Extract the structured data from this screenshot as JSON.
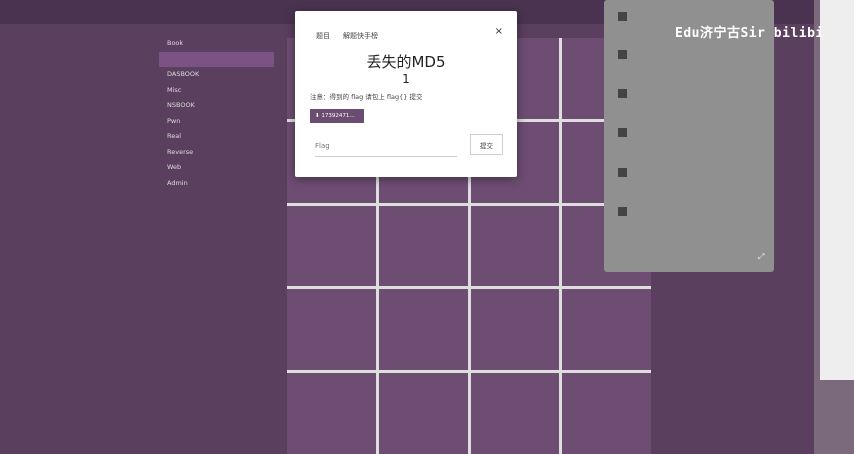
{
  "app": {
    "title": ""
  },
  "sidebar": {
    "items": [
      {
        "label": "Book",
        "active": false
      },
      {
        "label": "",
        "active": true
      },
      {
        "label": "DASBOOK",
        "active": false
      },
      {
        "label": "Misc",
        "active": false
      },
      {
        "label": "NSBOOK",
        "active": false
      },
      {
        "label": "Pwn",
        "active": false
      },
      {
        "label": "Real",
        "active": false
      },
      {
        "label": "Reverse",
        "active": false
      },
      {
        "label": "Web",
        "active": false
      },
      {
        "label": "Admin",
        "active": false
      }
    ]
  },
  "grid": {
    "tiles": [
      {
        "name": "",
        "score": ""
      },
      {
        "name": "",
        "score": ""
      },
      {
        "name": "",
        "score": ""
      },
      {
        "name": "",
        "score": ""
      },
      {
        "name": "",
        "score": ""
      },
      {
        "name": "",
        "score": ""
      },
      {
        "name": "",
        "score": ""
      },
      {
        "name": "",
        "score": ""
      },
      {
        "name": "",
        "score": ""
      },
      {
        "name": "",
        "score": ""
      },
      {
        "name": "",
        "score": ""
      },
      {
        "name": "",
        "score": ""
      },
      {
        "name": "",
        "score": ""
      },
      {
        "name": "",
        "score": ""
      },
      {
        "name": "",
        "score": ""
      },
      {
        "name": "",
        "score": ""
      },
      {
        "name": "",
        "score": ""
      },
      {
        "name": "",
        "score": ""
      },
      {
        "name": "",
        "score": ""
      },
      {
        "name": "",
        "score": ""
      }
    ]
  },
  "downloads": {
    "title": "",
    "items": [
      {
        "line1": "",
        "line2": "",
        "line3": ""
      },
      {
        "line1": "",
        "line2": "",
        "line3": ""
      },
      {
        "line1": "",
        "line2": "",
        "line3": ""
      },
      {
        "line1": "",
        "line2": "",
        "line3": ""
      },
      {
        "line1": "",
        "line2": "",
        "line3": ""
      },
      {
        "line1": "",
        "line2": "",
        "line3": ""
      }
    ],
    "footer": "",
    "icons": {
      "file": "file-icon",
      "expand": "expand-icon"
    }
  },
  "watermark": "Edu济宁古Sir bilibi",
  "modal": {
    "tabs": [
      "题目",
      "解题快手榜"
    ],
    "title": "丢失的MD5",
    "score": "1",
    "notice": "注意：得到的 flag 请包上 flag{} 提交",
    "file_button": "17392471...",
    "flag_placeholder": "Flag",
    "submit_label": "提交",
    "close_icon": "×"
  },
  "colors": {
    "background": "#5a3f5e",
    "tile": "#6d4d72",
    "sidebar_active": "#7a5283",
    "modal_bg": "#ffffff",
    "panel_bg": "#909090"
  }
}
